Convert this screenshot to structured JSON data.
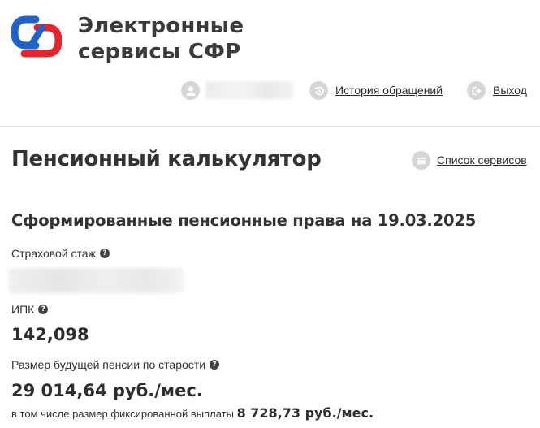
{
  "brand": {
    "line1": "Электронные",
    "line2": "сервисы СФР",
    "colors": {
      "blue": "#1f63c7",
      "red": "#e3262d"
    }
  },
  "userbar": {
    "user_icon": "user-icon",
    "history_icon": "history-icon",
    "history_label": "История обращений",
    "logout_icon": "logout-icon",
    "logout_label": "Выход"
  },
  "page": {
    "title": "Пенсионный калькулятор",
    "services_icon": "menu-list-icon",
    "services_label": "Список сервисов"
  },
  "rights": {
    "heading": "Сформированные пенсионные права на 19.03.2025",
    "insurance_label": "Страховой стаж",
    "ipk_label": "ИПК",
    "ipk_value": "142,098",
    "pension_label": "Размер будущей пенсии по старости",
    "pension_value": "29 014,64 руб./мес.",
    "fixed_prefix": "в том числе размер фиксированной выплаты",
    "fixed_value": "8 728,73 руб./мес."
  },
  "help_glyph": "?"
}
